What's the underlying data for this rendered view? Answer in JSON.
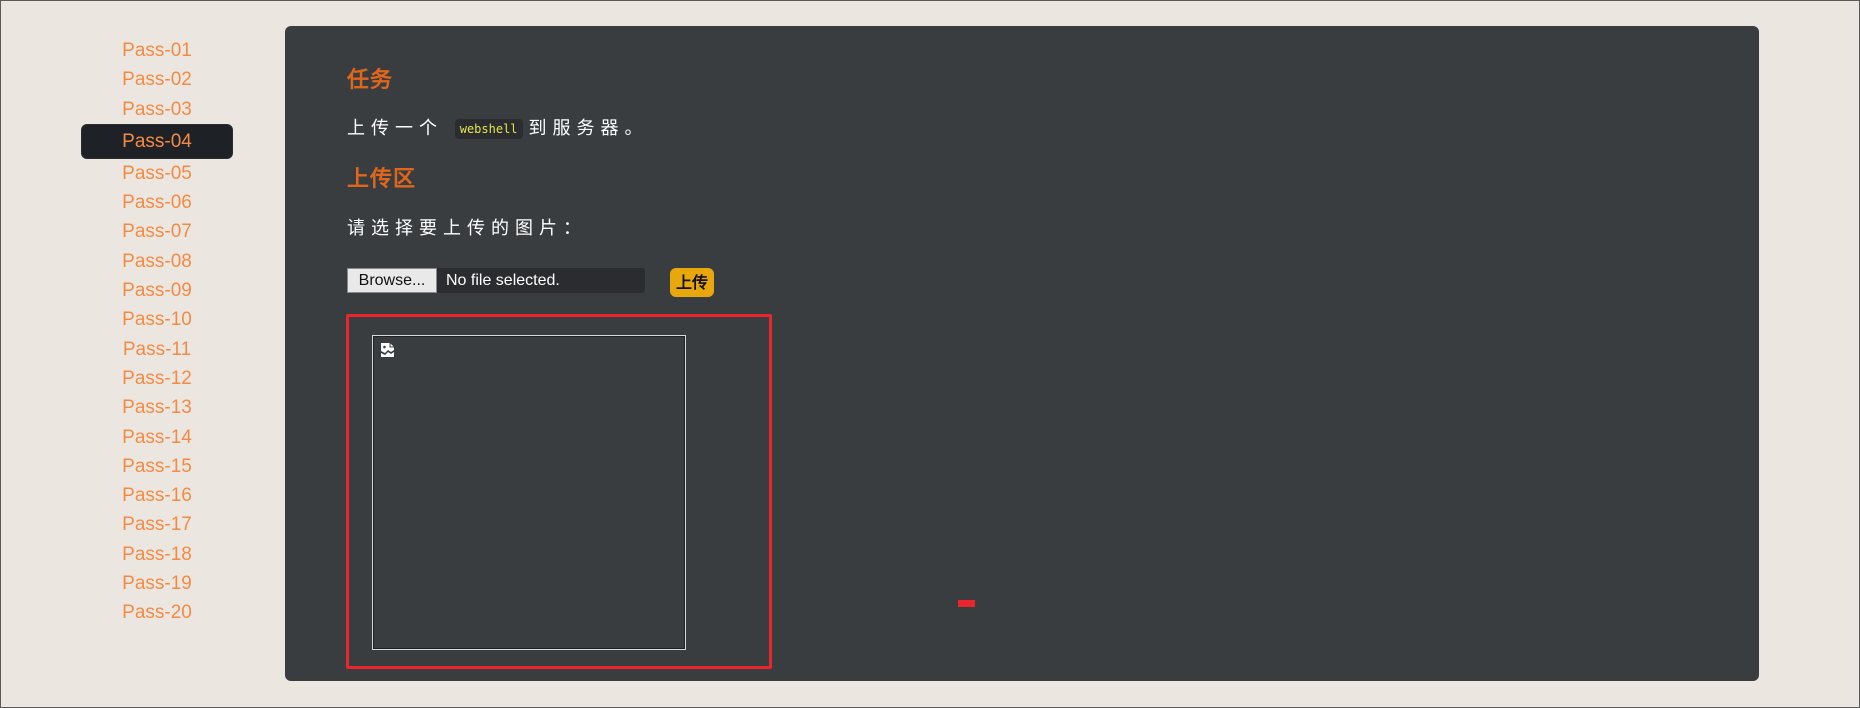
{
  "sidebar": {
    "items": [
      {
        "label": "Pass-01"
      },
      {
        "label": "Pass-02"
      },
      {
        "label": "Pass-03"
      },
      {
        "label": "Pass-04"
      },
      {
        "label": "Pass-05"
      },
      {
        "label": "Pass-06"
      },
      {
        "label": "Pass-07"
      },
      {
        "label": "Pass-08"
      },
      {
        "label": "Pass-09"
      },
      {
        "label": "Pass-10"
      },
      {
        "label": "Pass-11"
      },
      {
        "label": "Pass-12"
      },
      {
        "label": "Pass-13"
      },
      {
        "label": "Pass-14"
      },
      {
        "label": "Pass-15"
      },
      {
        "label": "Pass-16"
      },
      {
        "label": "Pass-17"
      },
      {
        "label": "Pass-18"
      },
      {
        "label": "Pass-19"
      },
      {
        "label": "Pass-20"
      }
    ],
    "active_index": 3
  },
  "task": {
    "title": "任务",
    "desc_prefix": "上传一个",
    "desc_code": "webshell",
    "desc_suffix": "到服务器。"
  },
  "upload": {
    "title": "上传区",
    "choose_label": "请选择要上传的图片：",
    "browse_label": "Browse...",
    "file_status": "No file selected.",
    "submit_label": "上传"
  },
  "preview": {
    "icon": "broken-image-icon"
  },
  "colors": {
    "page_bg": "#ebe7e0",
    "panel_bg": "#3a3d40",
    "nav_text": "#f58a45",
    "heading": "#e0661c",
    "accent_button": "#e8a80c",
    "highlight_box": "#e8262b"
  }
}
